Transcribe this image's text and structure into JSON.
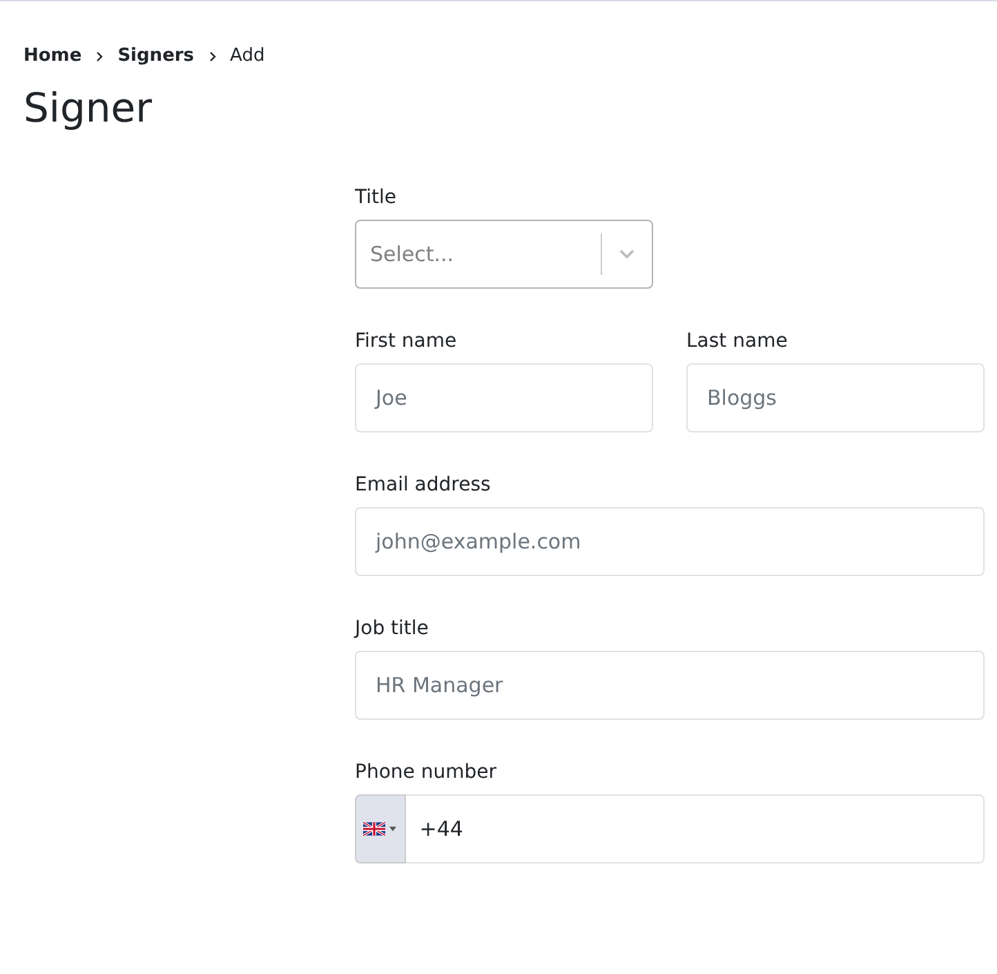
{
  "breadcrumb": [
    {
      "label": "Home"
    },
    {
      "label": "Signers"
    },
    {
      "label": "Add"
    }
  ],
  "page_title": "Signer",
  "form": {
    "title": {
      "label": "Title",
      "placeholder": "Select..."
    },
    "first_name": {
      "label": "First name",
      "placeholder": "Joe"
    },
    "last_name": {
      "label": "Last name",
      "placeholder": "Bloggs"
    },
    "email": {
      "label": "Email address",
      "placeholder": "john@example.com"
    },
    "job_title": {
      "label": "Job title",
      "placeholder": "HR Manager"
    },
    "phone": {
      "label": "Phone number",
      "value": "+44"
    }
  }
}
